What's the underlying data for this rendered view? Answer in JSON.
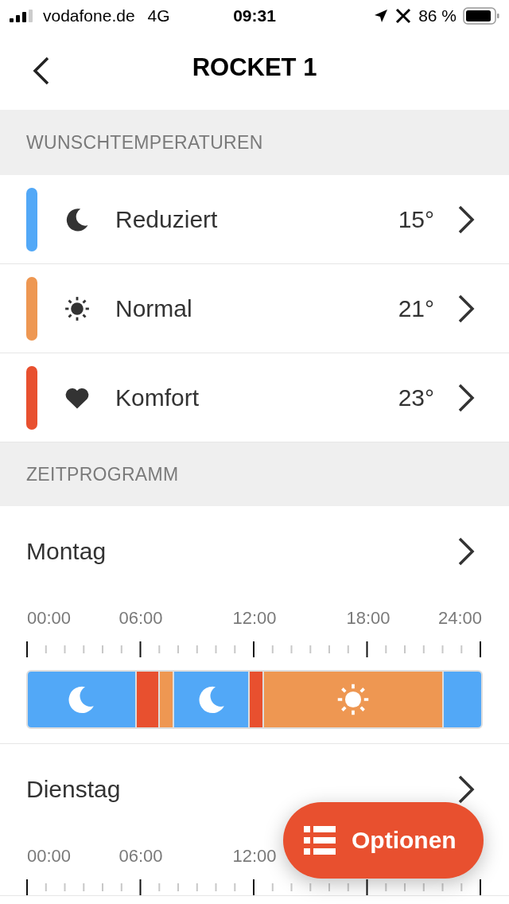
{
  "status_bar": {
    "carrier": "vodafone.de",
    "network": "4G",
    "time": "09:31",
    "battery": "86 %"
  },
  "nav": {
    "title": "ROCKET 1"
  },
  "temperatures": {
    "header": "WUNSCHTEMPERATUREN",
    "items": [
      {
        "kind": "moon",
        "label": "Reduziert",
        "value": "15°",
        "color": "#52a8f7"
      },
      {
        "kind": "sun",
        "label": "Normal",
        "value": "21°",
        "color": "#ee9752"
      },
      {
        "kind": "heart",
        "label": "Komfort",
        "value": "23°",
        "color": "#e8502f"
      }
    ]
  },
  "schedule": {
    "header": "ZEITPROGRAMM",
    "days": [
      {
        "name": "Montag",
        "time_labels": [
          "00:00",
          "06:00",
          "12:00",
          "18:00",
          "24:00"
        ],
        "segments": [
          {
            "kind": "moon",
            "color": "#52a8f7"
          },
          {
            "kind": "plain",
            "color": "#e8502f"
          },
          {
            "kind": "plain",
            "color": "#ee9752"
          },
          {
            "kind": "moon",
            "color": "#52a8f7"
          },
          {
            "kind": "plain",
            "color": "#e8502f"
          },
          {
            "kind": "sun",
            "color": "#ee9752"
          },
          {
            "kind": "plain",
            "color": "#52a8f7"
          }
        ]
      },
      {
        "name": "Dienstag",
        "time_labels": [
          "00:00",
          "06:00",
          "12:00"
        ]
      }
    ]
  },
  "options_button": {
    "label": "Optionen"
  }
}
